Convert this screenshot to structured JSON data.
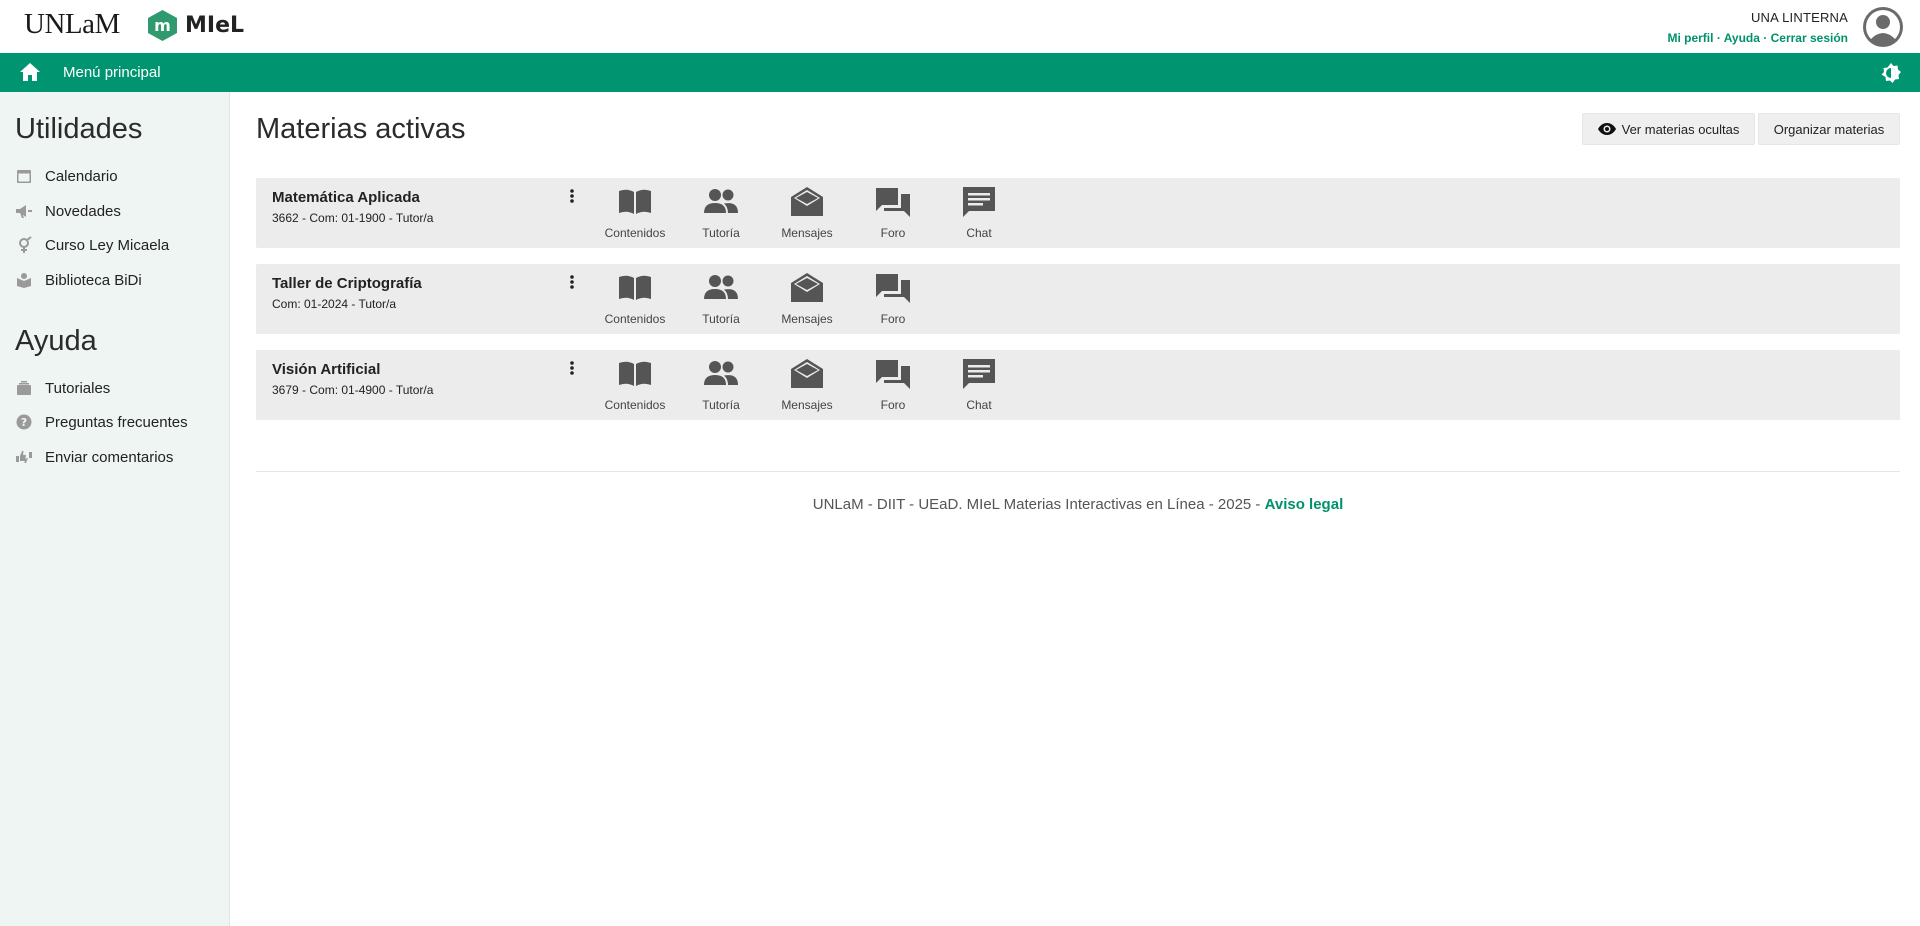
{
  "header": {
    "university_logo": "UNLaM",
    "app_name": "MIeL",
    "user_name": "UNA LINTERNA",
    "links": [
      "Mi perfil",
      "Ayuda",
      "Cerrar sesión"
    ]
  },
  "navbar": {
    "menu_label": "Menú principal"
  },
  "sidebar": {
    "utilities_heading": "Utilidades",
    "utilities": [
      {
        "label": "Calendario",
        "icon": "calendar-icon"
      },
      {
        "label": "Novedades",
        "icon": "megaphone-icon"
      },
      {
        "label": "Curso Ley Micaela",
        "icon": "gender-icon"
      },
      {
        "label": "Biblioteca BiDi",
        "icon": "library-icon"
      }
    ],
    "help_heading": "Ayuda",
    "help": [
      {
        "label": "Tutoriales",
        "icon": "tutorials-icon"
      },
      {
        "label": "Preguntas frecuentes",
        "icon": "question-icon"
      },
      {
        "label": "Enviar comentarios",
        "icon": "feedback-icon"
      }
    ]
  },
  "main": {
    "title": "Materias activas",
    "show_hidden_label": "Ver materias ocultas",
    "organize_label": "Organizar materias"
  },
  "courses": [
    {
      "name": "Matemática Aplicada",
      "subtitle": "3662 - Com: 01-1900 - Tutor/a",
      "actions": [
        "Contenidos",
        "Tutoría",
        "Mensajes",
        "Foro",
        "Chat"
      ]
    },
    {
      "name": "Taller de Criptografía",
      "subtitle": "Com: 01-2024 - Tutor/a",
      "actions": [
        "Contenidos",
        "Tutoría",
        "Mensajes",
        "Foro"
      ]
    },
    {
      "name": "Visión Artificial",
      "subtitle": "3679 - Com: 01-4900 - Tutor/a",
      "actions": [
        "Contenidos",
        "Tutoría",
        "Mensajes",
        "Foro",
        "Chat"
      ]
    }
  ],
  "footer": {
    "text": "UNLaM - DIIT - UEaD. MIeL Materias Interactivas en Línea - 2025 - ",
    "legal_link": "Aviso legal"
  },
  "colors": {
    "brand_green": "#009570",
    "link_green": "#00926b",
    "card_bg": "#ececec",
    "sidebar_bg": "#eff5f3"
  }
}
